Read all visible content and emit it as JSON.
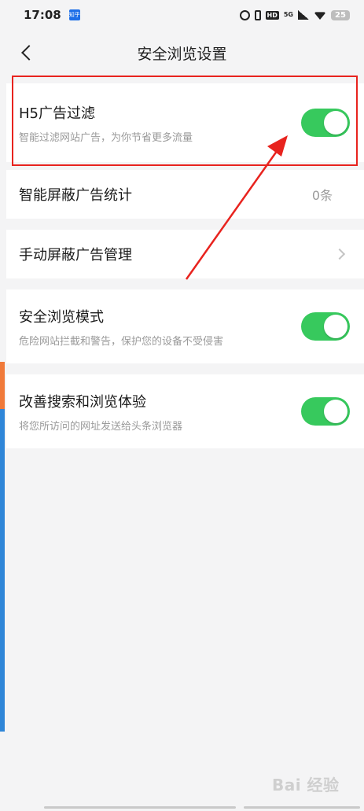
{
  "status_bar": {
    "time": "17:08",
    "app_icon_label": "知乎",
    "network_badge": "HD",
    "network_type": "5G",
    "battery_level": "25",
    "icons": [
      "alarm-icon",
      "vibrate-icon",
      "hd-icon",
      "signal-icon",
      "wifi-icon",
      "battery-icon"
    ]
  },
  "nav": {
    "title": "安全浏览设置",
    "back_icon": "chevron-left-icon"
  },
  "settings": {
    "h5_filter": {
      "title": "H5广告过滤",
      "subtitle": "智能过滤网站广告，为你节省更多流量",
      "enabled": true
    },
    "smart_block_stats": {
      "title": "智能屏蔽广告统计",
      "value": "0条"
    },
    "manual_block": {
      "title": "手动屏蔽广告管理",
      "chevron_icon": "chevron-right-icon"
    },
    "safe_mode": {
      "title": "安全浏览模式",
      "subtitle": "危险网站拦截和警告，保护您的设备不受侵害",
      "enabled": true
    },
    "improve_search": {
      "title": "改善搜索和浏览体验",
      "subtitle": "将您所访问的网址发送给头条浏览器",
      "enabled": true
    }
  },
  "annotation": {
    "highlight_color": "#e8231e"
  },
  "watermark": "Bai 经验",
  "colors": {
    "toggle_on": "#37c95d",
    "background": "#f4f4f5"
  }
}
